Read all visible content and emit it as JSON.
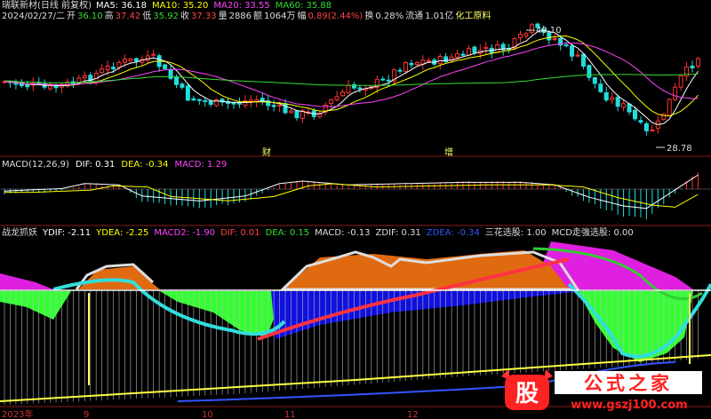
{
  "app": {
    "title": "瑞联新材(日线 前复权)"
  },
  "info_line": {
    "date": "2024/02/27/二",
    "open_label": "开",
    "open": "36.10",
    "high_label": "高",
    "high": "37.42",
    "low_label": "低",
    "low": "35.92",
    "close_label": "收",
    "close": "37.33",
    "vol_label": "量",
    "vol": "2886",
    "amt_label": "额",
    "amt": "1064万",
    "chg_label": "幅",
    "chg": "0.89(2.44%)",
    "turnover_label": "换",
    "turnover": "0.28%",
    "float_label": "流通",
    "float": "1.01亿",
    "sector": "化工原料"
  },
  "main_panel": {
    "ma_labels": [
      {
        "text": "MA5: 36.18",
        "color": "#ffffff"
      },
      {
        "text": "MA10: 35.20",
        "color": "#ffff00"
      },
      {
        "text": "MA20: 33.55",
        "color": "#ff44ff"
      },
      {
        "text": "MA60: 35.88",
        "color": "#33dd33"
      }
    ],
    "high_mark": "40.10",
    "low_mark": "28.78",
    "event_marks": [
      "财",
      "增"
    ]
  },
  "macd_panel": {
    "labels": [
      {
        "text": "MACD(12,26,9)",
        "color": "#dddddd"
      },
      {
        "text": "DIF: 0.31",
        "color": "#ffffff"
      },
      {
        "text": "DEA: -0.34",
        "color": "#ffff00"
      },
      {
        "text": "MACD: 1.29",
        "color": "#ff44ff"
      }
    ]
  },
  "indicator_panel": {
    "labels": [
      {
        "text": "战龙抓妖",
        "color": "#dddddd"
      },
      {
        "text": "YDIF: -2.11",
        "color": "#ffffff"
      },
      {
        "text": "YDEA: -2.25",
        "color": "#ffff00"
      },
      {
        "text": "MACD2: -1.90",
        "color": "#ff44ff"
      },
      {
        "text": "DIF: 0.01",
        "color": "#ff4444"
      },
      {
        "text": "DEA: 0.15",
        "color": "#33dd33"
      },
      {
        "text": "MACD: -0.13",
        "color": "#dddddd"
      },
      {
        "text": "ZDIF: 0.31",
        "color": "#dddddd"
      },
      {
        "text": "ZDEA: -0.34",
        "color": "#3355ff"
      },
      {
        "text": "三花选股: 1.00",
        "color": "#dddddd"
      },
      {
        "text": "MCD走強选股: 0.00",
        "color": "#dddddd"
      }
    ]
  },
  "time_axis": [
    "2023年",
    "9",
    "10",
    "11",
    "12"
  ],
  "watermark": {
    "logo": "股",
    "text": "公式之家",
    "url": "www.gszj100.com"
  },
  "chart_data": {
    "type": "candlestick",
    "panels": [
      "price",
      "MACD(12,26,9)",
      "战龙抓妖"
    ],
    "price_marks": {
      "high": 40.1,
      "low": 28.78
    },
    "last_bar": {
      "open": 36.1,
      "high": 37.42,
      "low": 35.92,
      "close": 37.33
    },
    "moving_averages": {
      "MA5": 36.18,
      "MA10": 35.2,
      "MA20": 33.55,
      "MA60": 35.88
    },
    "macd": {
      "DIF": 0.31,
      "DEA": -0.34,
      "MACD": 1.29
    },
    "time_labels": [
      "2023年",
      "9",
      "10",
      "11",
      "12"
    ]
  }
}
